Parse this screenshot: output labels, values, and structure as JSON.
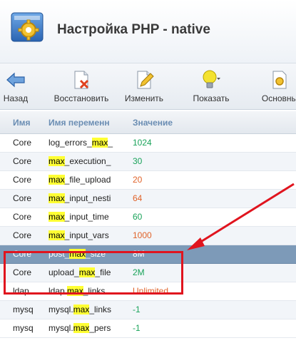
{
  "window": {
    "title": "Настройка PHP - native"
  },
  "toolbar": {
    "back": "Назад",
    "restore": "Восстановить",
    "edit": "Изменить",
    "show": "Показать",
    "main": "Основны"
  },
  "grid": {
    "columns": [
      "Имя",
      "Имя переменн",
      "Значение"
    ],
    "rows": [
      {
        "module": "Core",
        "pre": "log_errors_",
        "hl": "max",
        "post": "_",
        "value": "1024",
        "tone": "green"
      },
      {
        "module": "Core",
        "pre": "",
        "hl": "max",
        "post": "_execution_",
        "value": "30",
        "tone": "green"
      },
      {
        "module": "Core",
        "pre": "",
        "hl": "max",
        "post": "_file_upload",
        "value": "20",
        "tone": "orange"
      },
      {
        "module": "Core",
        "pre": "",
        "hl": "max",
        "post": "_input_nesti",
        "value": "64",
        "tone": "orange"
      },
      {
        "module": "Core",
        "pre": "",
        "hl": "max",
        "post": "_input_time",
        "value": "60",
        "tone": "green"
      },
      {
        "module": "Core",
        "pre": "",
        "hl": "max",
        "post": "_input_vars",
        "value": "1000",
        "tone": "orange"
      },
      {
        "module": "Core",
        "pre": "post_",
        "hl": "max",
        "post": "_size",
        "value": "8M",
        "tone": "green"
      },
      {
        "module": "Core",
        "pre": "upload_",
        "hl": "max",
        "post": "_file",
        "value": "2M",
        "tone": "green"
      },
      {
        "module": "ldap",
        "pre": "ldap.",
        "hl": "max",
        "post": "_links",
        "value": "Unlimited",
        "tone": "orange"
      },
      {
        "module": "mysq",
        "pre": "mysql.",
        "hl": "max",
        "post": "_links",
        "value": "-1",
        "tone": "green"
      },
      {
        "module": "mysq",
        "pre": "mysql.",
        "hl": "max",
        "post": "_pers",
        "value": "-1",
        "tone": "green"
      }
    ],
    "selected_row": 6
  },
  "colors": {
    "accent": "#6a8db3",
    "selection": "#7d9ab8",
    "highlight": "#ffff33",
    "annotation": "#e0141e"
  },
  "icons": [
    "php-settings-icon",
    "back-arrow-icon",
    "restore-icon",
    "edit-icon",
    "lightbulb-icon",
    "settings-icon"
  ]
}
